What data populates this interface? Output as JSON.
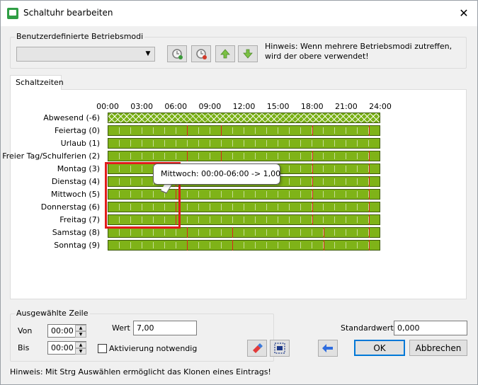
{
  "window": {
    "title": "Schaltuhr bearbeiten",
    "close_glyph": "✕"
  },
  "modes": {
    "label": "Benutzerdefinierte Betriebsmodi",
    "selected": "",
    "hint": "Hinweis: Wenn mehrere Betriebsmodi zutreffen, wird der obere verwendet!"
  },
  "tab": {
    "label": "Schaltzeiten"
  },
  "schedule": {
    "time_labels": [
      "00:00",
      "03:00",
      "06:00",
      "09:00",
      "12:00",
      "15:00",
      "18:00",
      "21:00",
      "24:00"
    ],
    "days": [
      {
        "label": "Abwesend (-6)",
        "pattern": "hatch",
        "splits": []
      },
      {
        "label": "Feiertag (0)",
        "pattern": "solid",
        "splits": [
          7,
          10,
          18,
          23
        ]
      },
      {
        "label": "Urlaub (1)",
        "pattern": "solid",
        "splits": []
      },
      {
        "label": "Freier Tag/Schulferien (2)",
        "pattern": "solid",
        "splits": [
          7,
          10,
          18,
          23
        ]
      },
      {
        "label": "Montag (3)",
        "pattern": "solid",
        "splits": [
          6,
          18,
          23
        ]
      },
      {
        "label": "Dienstag (4)",
        "pattern": "solid",
        "splits": [
          6,
          18,
          23
        ]
      },
      {
        "label": "Mittwoch (5)",
        "pattern": "solid",
        "splits": [
          6,
          18,
          23
        ]
      },
      {
        "label": "Donnerstag (6)",
        "pattern": "solid",
        "splits": [
          6,
          18,
          23
        ]
      },
      {
        "label": "Freitag (7)",
        "pattern": "solid",
        "splits": [
          6,
          18,
          23
        ]
      },
      {
        "label": "Samstag (8)",
        "pattern": "solid",
        "splits": [
          7,
          11,
          19,
          23
        ]
      },
      {
        "label": "Sonntag (9)",
        "pattern": "solid",
        "splits": [
          7,
          11,
          19,
          23
        ]
      }
    ],
    "tooltip": "Mittwoch: 00:00-06:00 -> 1,00",
    "colors": {
      "bar": "#7fb318",
      "split": "#d9261c",
      "highlight": "#e01b1b"
    }
  },
  "selection": {
    "group_label": "Ausgewählte Zeile",
    "from_label": "Von",
    "from_value": "00:00",
    "to_label": "Bis",
    "to_value": "00:00",
    "value_label": "Wert",
    "value": "7,00",
    "activation_label": "Aktivierung notwendig"
  },
  "standard": {
    "label": "Standardwert:",
    "value": "0,000"
  },
  "buttons": {
    "ok": "OK",
    "cancel": "Abbrechen"
  },
  "footer_hint": "Hinweis: Mit Strg Auswählen ermöglicht das Klonen eines Eintrags!"
}
